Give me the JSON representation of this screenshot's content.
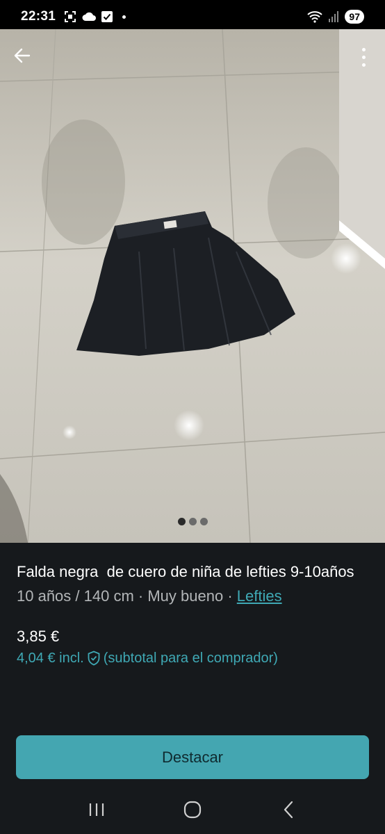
{
  "status_bar": {
    "time": "22:31",
    "battery": "97",
    "icons_left": [
      "screenshot-icon",
      "cloud-icon",
      "check-box-icon",
      "dot-icon"
    ],
    "icons_right": [
      "wifi-icon",
      "signal-icon",
      "battery-icon"
    ]
  },
  "header": {
    "back_icon": "arrow-left-icon",
    "more_icon": "more-vertical-icon"
  },
  "gallery": {
    "page_count": 3,
    "active_index": 0
  },
  "item": {
    "title": "Falda negra  de cuero de niña de lefties 9-10años",
    "size": "10 años / 140 cm",
    "separator": " · ",
    "condition": "Muy bueno",
    "brand": "Lefties",
    "price": "3,85 €",
    "price_incl": "4,04 €  incl.",
    "price_incl_note": "(subtotal para el comprador)"
  },
  "actions": {
    "primary_label": "Destacar"
  },
  "colors": {
    "accent": "#44a6b1",
    "link": "#3fa9b5",
    "background": "#16191c"
  },
  "nav": {
    "items": [
      "recents-icon",
      "home-icon",
      "back-icon"
    ]
  }
}
